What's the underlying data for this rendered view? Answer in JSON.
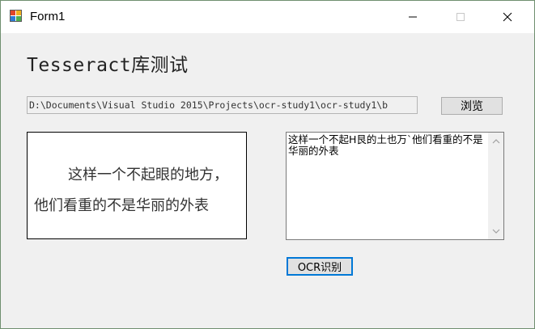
{
  "window": {
    "title": "Form1",
    "icon": "winforms-app-icon",
    "controls": {
      "minimize": "minimize-icon",
      "maximize": "maximize-icon",
      "close": "close-icon"
    }
  },
  "main": {
    "heading": "Tesseract库测试",
    "path_value": "D:\\Documents\\Visual Studio 2015\\Projects\\ocr-study1\\ocr-study1\\b",
    "browse_label": "浏览",
    "image_text": {
      "line1": "这样一个不起眼的地方，",
      "line2": "他们看重的不是华丽的外表"
    },
    "ocr_result": "这样一个不起H艮的土也万`他们看重的不是华丽的外表",
    "ocr_button_label": "OCR识别"
  }
}
